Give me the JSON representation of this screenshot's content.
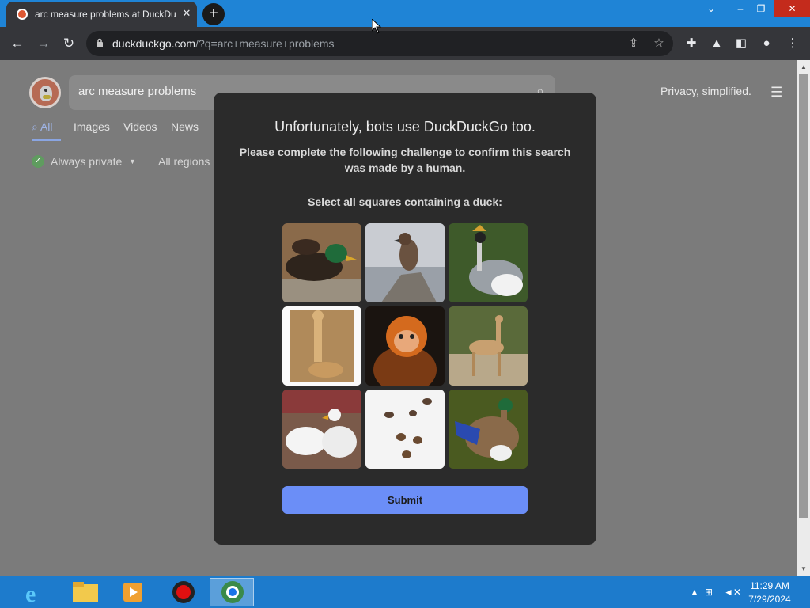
{
  "browser": {
    "tab_title": "arc measure problems at DuckDuckGo",
    "tab_close": "✕",
    "new_tab": "+",
    "url_domain": "duckduckgo.com",
    "url_rest": "/?q=arc+measure+problems"
  },
  "page": {
    "search_query": "arc measure problems",
    "privacy_text": "Privacy, simplified.",
    "tabs": [
      {
        "label": "All"
      },
      {
        "label": "Images"
      },
      {
        "label": "Videos"
      },
      {
        "label": "News"
      }
    ],
    "always_private": "Always private",
    "regions": "All regions"
  },
  "challenge": {
    "title": "Unfortunately, bots use DuckDuckGo too.",
    "subtitle": "Please complete the following challenge to confirm this search was made by a human.",
    "prompt": "Select all squares containing a duck:",
    "tiles": [
      {
        "subject": "mallard duck"
      },
      {
        "subject": "sparrow on rock"
      },
      {
        "subject": "crowned crane"
      },
      {
        "subject": "giraffe and calf"
      },
      {
        "subject": "baby monkey"
      },
      {
        "subject": "giraffe walking"
      },
      {
        "subject": "white ducks"
      },
      {
        "subject": "ducks on snow"
      },
      {
        "subject": "mallard duck spreading wing"
      }
    ],
    "submit_label": "Submit"
  },
  "taskbar": {
    "time": "11:29 AM",
    "date": "7/29/2024"
  },
  "colors": {
    "tabstrip": "#1f84d6",
    "chrome": "#35363a",
    "modal": "#2b2b2b",
    "submit": "#6b8ef7",
    "taskbar": "#1d7bcc"
  }
}
